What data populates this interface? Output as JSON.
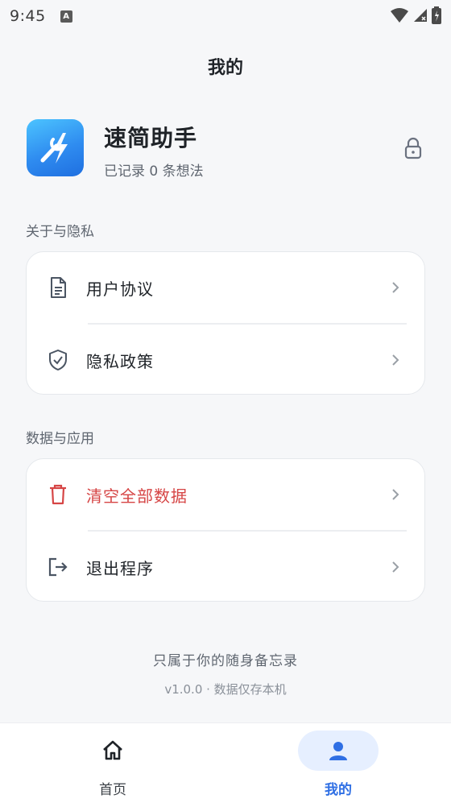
{
  "status_bar": {
    "time": "9:45",
    "notification_icon": "a-icon"
  },
  "header": {
    "title": "我的"
  },
  "profile": {
    "app_name": "速简助手",
    "subtitle": "已记录 0 条想法",
    "logo_icon": "lightning-wrench-icon",
    "lock_icon": "lock-icon"
  },
  "sections": {
    "about": {
      "label": "关于与隐私",
      "items": [
        {
          "label": "用户协议",
          "icon": "document-icon"
        },
        {
          "label": "隐私政策",
          "icon": "shield-check-icon"
        }
      ]
    },
    "data": {
      "label": "数据与应用",
      "items": [
        {
          "label": "清空全部数据",
          "icon": "trash-icon",
          "color": "#d64545"
        },
        {
          "label": "退出程序",
          "icon": "exit-icon"
        }
      ]
    }
  },
  "footer": {
    "tagline": "只属于你的随身备忘录",
    "version": "v1.0.0 · 数据仅存本机"
  },
  "bottom_nav": {
    "items": [
      {
        "label": "首页",
        "icon": "home-icon",
        "active": false
      },
      {
        "label": "我的",
        "icon": "person-icon",
        "active": true
      }
    ]
  },
  "colors": {
    "accent": "#2f6fe4",
    "danger": "#d64545",
    "background": "#f6f7f9"
  }
}
